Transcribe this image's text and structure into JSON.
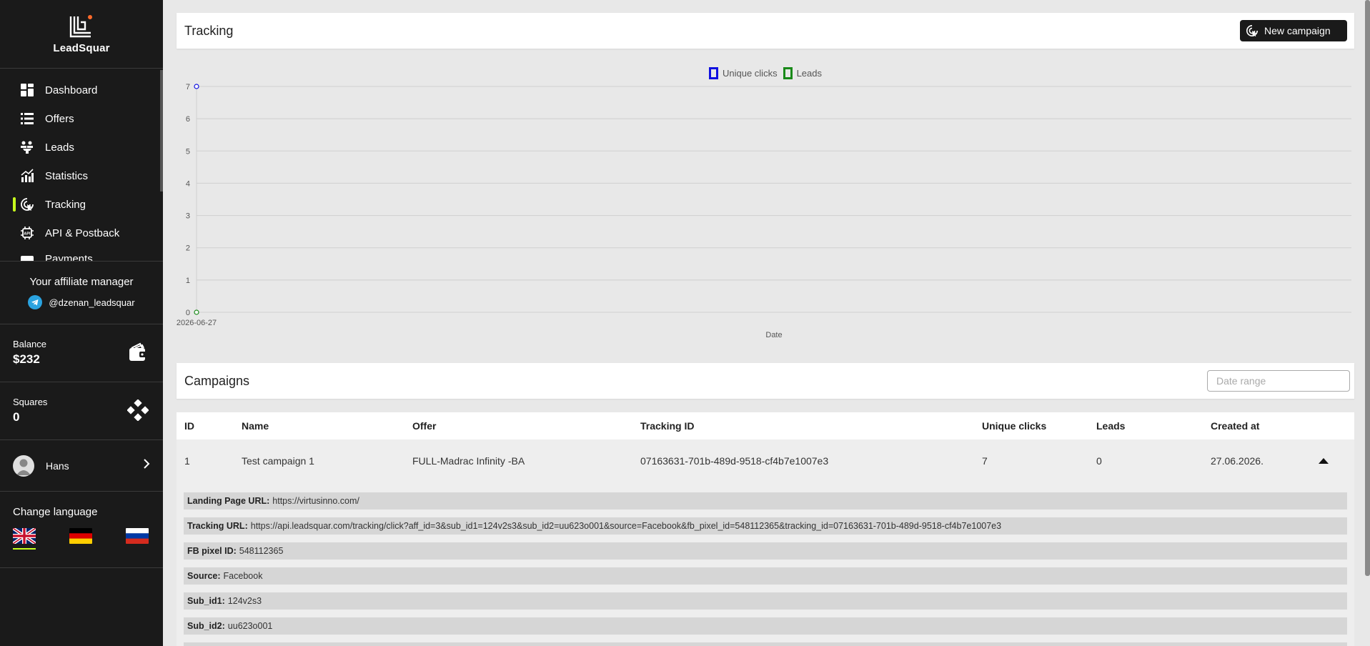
{
  "brand": {
    "name": "LeadSquar"
  },
  "nav": {
    "items": [
      {
        "label": "Dashboard",
        "icon": "dashboard-icon"
      },
      {
        "label": "Offers",
        "icon": "list-icon"
      },
      {
        "label": "Leads",
        "icon": "leads-icon"
      },
      {
        "label": "Statistics",
        "icon": "statistics-icon"
      },
      {
        "label": "Tracking",
        "icon": "tracking-icon",
        "active": true
      },
      {
        "label": "API & Postback",
        "icon": "api-icon"
      },
      {
        "label": "Payments",
        "icon": "payments-icon"
      }
    ]
  },
  "manager": {
    "title": "Your affiliate manager",
    "handle": "@dzenan_leadsquar"
  },
  "balance": {
    "label": "Balance",
    "value": "$232"
  },
  "squares": {
    "label": "Squares",
    "value": "0"
  },
  "user": {
    "name": "Hans"
  },
  "language": {
    "title": "Change language",
    "options": [
      "English",
      "German",
      "Russian"
    ],
    "active": "English"
  },
  "tracking": {
    "title": "Tracking",
    "new_campaign_label": "New campaign"
  },
  "chart_data": {
    "type": "line",
    "x": [
      "2026-06-27"
    ],
    "series": [
      {
        "name": "Unique clicks",
        "values": [
          7
        ],
        "color": "#1010e0"
      },
      {
        "name": "Leads",
        "values": [
          0
        ],
        "color": "#1a8a1a"
      }
    ],
    "xlabel": "Date",
    "ylabel": "",
    "ylim": [
      0,
      7
    ],
    "yticks": [
      0,
      1,
      2,
      3,
      4,
      5,
      6,
      7
    ],
    "grid": true,
    "legend": "top-center"
  },
  "campaigns": {
    "title": "Campaigns",
    "date_placeholder": "Date range",
    "columns": [
      "ID",
      "Name",
      "Offer",
      "Tracking ID",
      "Unique clicks",
      "Leads",
      "Created at"
    ],
    "rows": [
      {
        "id": "1",
        "name": "Test campaign 1",
        "offer": "FULL-Madrac Infinity -BA",
        "tracking_id": "07163631-701b-489d-9518-cf4b7e1007e3",
        "unique_clicks": "7",
        "leads": "0",
        "created_at": "27.06.2026."
      }
    ],
    "details": [
      {
        "label": "Landing Page URL:",
        "value": "https://virtusinno.com/"
      },
      {
        "label": "Tracking URL:",
        "value": "https://api.leadsquar.com/tracking/click?aff_id=3&sub_id1=124v2s3&sub_id2=uu623o001&source=Facebook&fb_pixel_id=548112365&tracking_id=07163631-701b-489d-9518-cf4b7e1007e3"
      },
      {
        "label": "FB pixel ID:",
        "value": "548112365"
      },
      {
        "label": "Source:",
        "value": "Facebook"
      },
      {
        "label": "Sub_id1:",
        "value": "124v2s3"
      },
      {
        "label": "Sub_id2:",
        "value": "uu623o001"
      }
    ]
  }
}
